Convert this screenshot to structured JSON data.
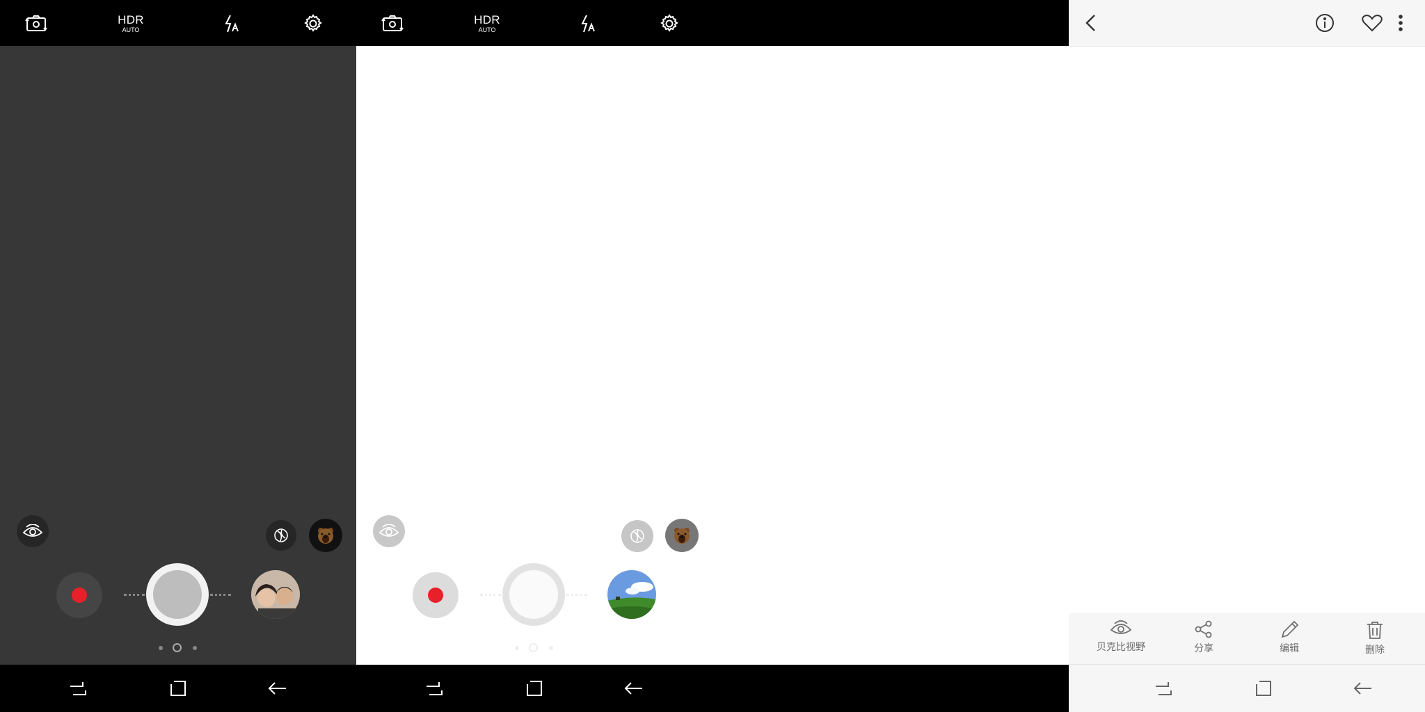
{
  "camera_top_bar": {
    "icons": [
      "switch-camera-icon",
      "hdr-toggle",
      "flash-auto-icon",
      "settings-gear-icon"
    ],
    "hdr_label": "HDR",
    "hdr_mode": "AUTO"
  },
  "camera_screens": [
    {
      "state": "live",
      "thumbnail": "selfie-photo",
      "pager_active": 1
    },
    {
      "state": "capturing",
      "thumbnail": "landscape-photo",
      "pager_active": 1
    }
  ],
  "camera_controls": {
    "icons": [
      "bixby-vision-eye-icon",
      "filter-effects-icon",
      "bear-sticker-icon",
      "record-video-icon",
      "shutter-button",
      "gallery-thumbnail"
    ]
  },
  "gallery_viewer": {
    "header_icons": [
      "back-chevron-icon",
      "info-icon",
      "favorite-heart-icon",
      "more-options-icon"
    ],
    "tools": [
      {
        "icon": "bixby-vision-eye-icon",
        "label": "贝克比视野"
      },
      {
        "icon": "share-icon",
        "label": "分享"
      },
      {
        "icon": "edit-pencil-icon",
        "label": "编辑"
      },
      {
        "icon": "trash-icon",
        "label": "删除"
      }
    ]
  },
  "system_nav": {
    "icons": [
      "recent-apps-icon",
      "home-icon",
      "back-arrow-icon"
    ]
  },
  "colors": {
    "record_red": "#e8202a",
    "viewfinder_dark": "#373737",
    "bar_black": "#000000"
  }
}
